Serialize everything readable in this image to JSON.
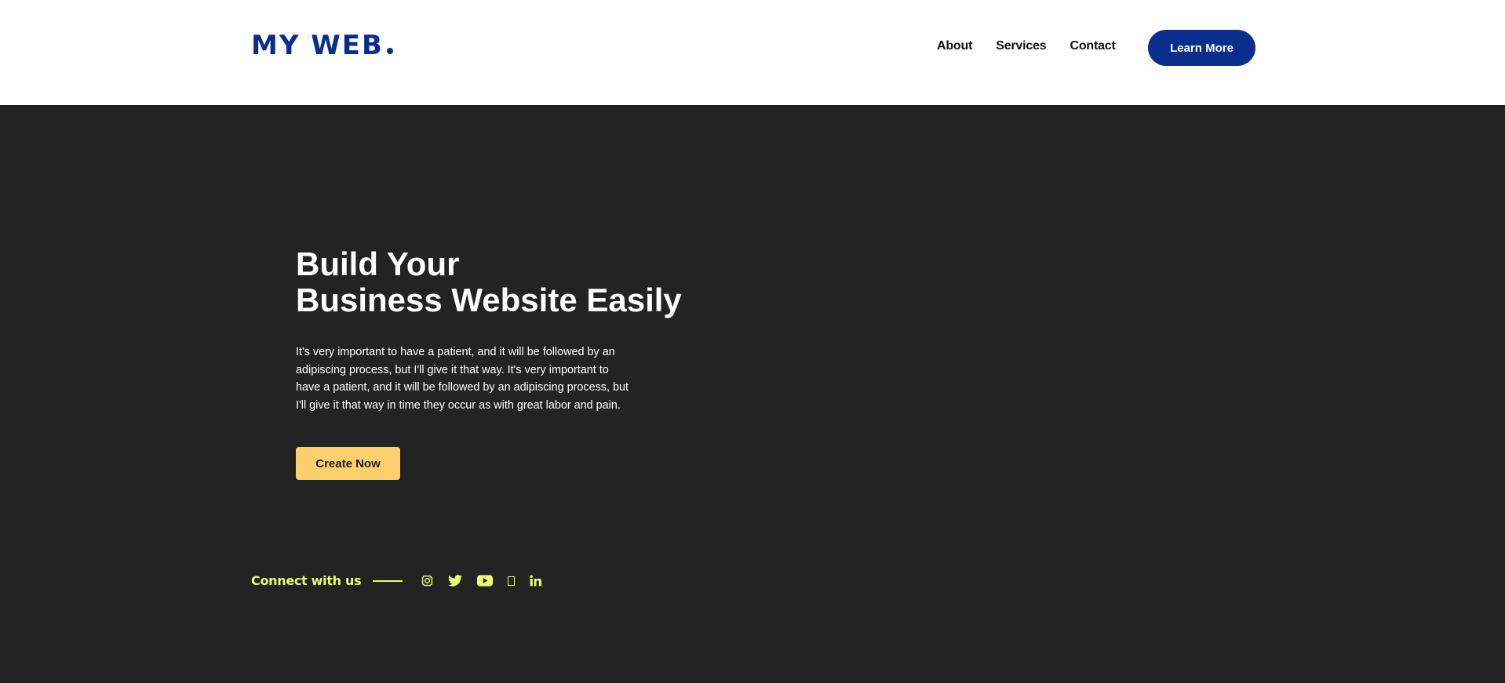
{
  "header": {
    "logo_text": "MY WEB",
    "nav": [
      "About",
      "Services",
      "Contact"
    ],
    "cta_label": "Learn More"
  },
  "hero": {
    "title_line1": "Build Your",
    "title_line2": "Business Website Easily",
    "description": "It's very important to have a patient, and it will be followed by an adipiscing process, but I'll give it that way. It's very important to have a patient, and it will be followed by an adipiscing process, but I'll give it that way in time they occur as with great labor and pain.",
    "button_label": "Create Now"
  },
  "connect": {
    "label": "Connect with us",
    "icons": [
      "instagram-icon",
      "twitter-icon",
      "youtube-icon",
      "unknown-glyph-icon",
      "linkedin-icon"
    ]
  },
  "colors": {
    "brand": "#0a2e8c",
    "hero_bg": "#232323",
    "create_button": "#fecf6d",
    "accent": "#e7fb73"
  }
}
